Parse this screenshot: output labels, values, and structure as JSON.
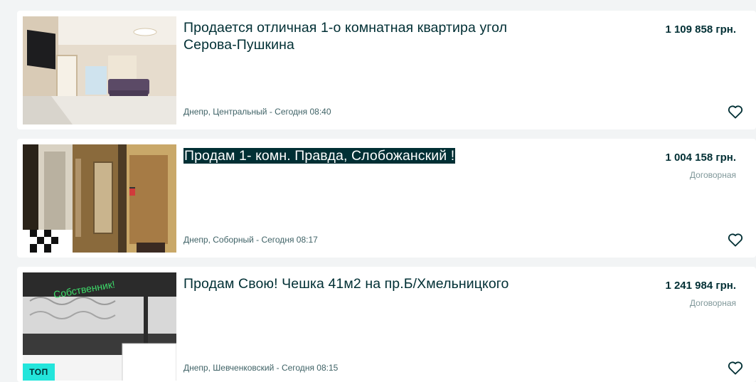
{
  "listings": [
    {
      "title": "Продается отличная 1-о комнатная квартира угол Серова-Пушкина",
      "price": "1 109 858 грн.",
      "negotiable": "",
      "location_time": "Днепр, Центральный - Сегодня 08:40",
      "photo": "apartment-living-room-photo"
    },
    {
      "title": "Продам 1- комн. Правда, Слобожанский !",
      "price": "1 004 158 грн.",
      "negotiable": "Договорная",
      "location_time": "Днепр, Соборный - Сегодня 08:17",
      "photo": "apartment-hallway-photo"
    },
    {
      "title": "Продам Свою! Чешка 41м2 на пр.Б/Хмельницкого",
      "price": "1 241 984 грн.",
      "negotiable": "Договорная",
      "location_time": "Днепр, Шевченковский - Сегодня 08:15",
      "photo": "apartment-bathroom-photo",
      "photo_overlay_text": "Собственник!",
      "badge": "ТОП"
    }
  ],
  "colors": {
    "page_bg": "#f2f4f5",
    "card_bg": "#ffffff",
    "text": "#002f34",
    "muted": "#7f9799",
    "badge_bg": "#23e5db"
  },
  "icons": {
    "favorite": "heart-outline-icon"
  }
}
